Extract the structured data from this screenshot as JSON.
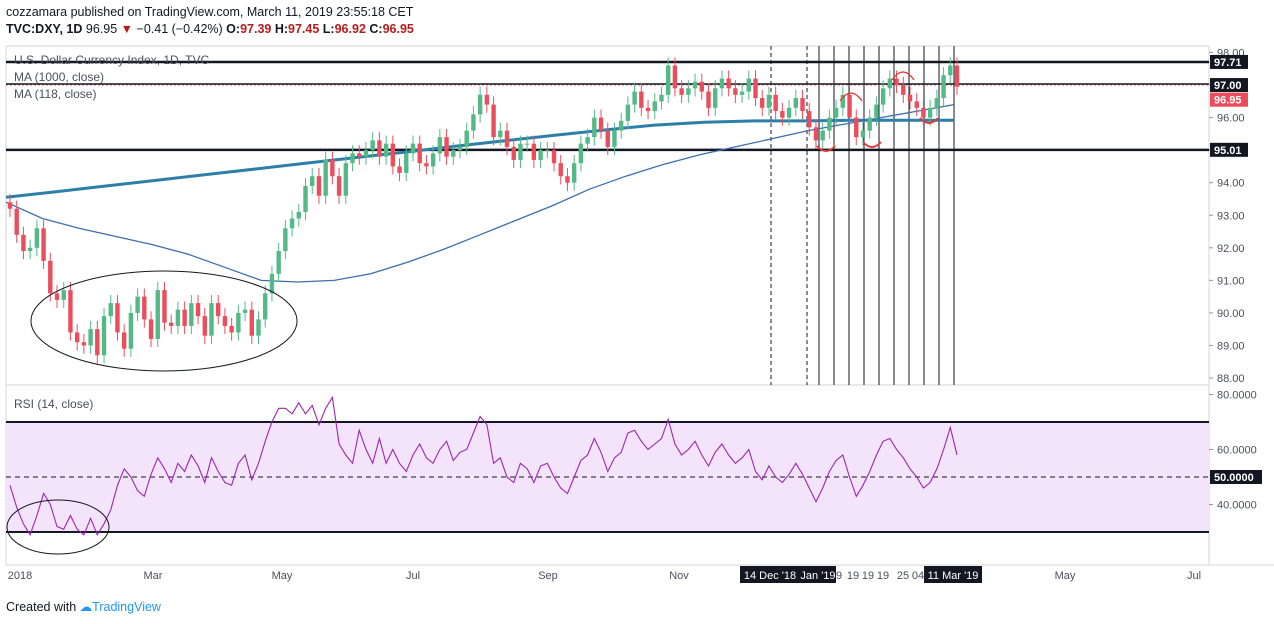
{
  "header": {
    "published_line": "cozzamara published on TradingView.com, March 11, 2019 23:55:18 CET",
    "symbol": "TVC:DXY, 1D",
    "last": "96.95",
    "change": "−0.41 (−0.42%)",
    "o_label": "O:",
    "o": "97.39",
    "h_label": "H:",
    "h": "97.45",
    "l_label": "L:",
    "l": "96.92",
    "c_label": "C:",
    "c": "96.95"
  },
  "legends": {
    "series_title": "U.S. Dollar Currency Index, 1D, TVC",
    "ma1000": "MA (1000, close)",
    "ma118": "MA (118, close)",
    "rsi": "RSI (14, close)"
  },
  "footer": {
    "created_with": "Created with",
    "brand": "TradingView"
  },
  "colors": {
    "bull": "#53b987",
    "bear": "#eb4d5c",
    "ma1000": "#2e7fa8",
    "ma118": "#3a6fb0",
    "rsi_line": "#9c27b0",
    "rsi_band": "#f3e3fb",
    "annotation_red": "#e53935"
  },
  "chart_data": [
    {
      "type": "candlestick",
      "title": "U.S. Dollar Currency Index, 1D, TVC",
      "ylim": [
        87.8,
        98.0
      ],
      "y_ticks": [
        "88.00",
        "89.00",
        "90.00",
        "91.00",
        "92.00",
        "93.00",
        "94.00",
        "95.00",
        "96.00",
        "97.00",
        "98.00"
      ],
      "x_ticks": [
        "2018",
        "Mar",
        "May",
        "Jul",
        "Sep",
        "Nov",
        "14 Dec '18",
        "Jan '19",
        "9",
        "19",
        "19",
        "19",
        "25",
        "04",
        "11 Mar '19",
        "May",
        "Jul"
      ],
      "horizontal_levels": [
        "97.71",
        "97.00",
        "95.01"
      ],
      "price_tags": [
        "97.71",
        "97.00",
        "96.95",
        "95.01"
      ],
      "closes": [
        93.2,
        92.4,
        91.9,
        92.0,
        92.6,
        91.6,
        90.6,
        90.4,
        90.7,
        89.4,
        89.1,
        89.0,
        89.5,
        88.7,
        89.9,
        90.3,
        89.4,
        88.9,
        90.0,
        90.5,
        89.8,
        89.2,
        90.7,
        89.7,
        89.6,
        90.1,
        89.6,
        90.3,
        89.9,
        89.3,
        90.3,
        89.9,
        89.6,
        89.4,
        90.0,
        90.1,
        89.3,
        89.8,
        90.6,
        91.2,
        91.9,
        92.6,
        92.9,
        93.1,
        93.9,
        94.2,
        93.6,
        94.7,
        94.2,
        93.6,
        94.6,
        94.9,
        94.8,
        95.0,
        95.3,
        94.8,
        95.2,
        94.5,
        94.3,
        94.9,
        95.2,
        94.6,
        94.5,
        94.9,
        95.4,
        94.8,
        95.0,
        95.1,
        95.6,
        96.1,
        96.7,
        96.4,
        95.4,
        95.6,
        95.1,
        94.7,
        95.2,
        95.2,
        94.7,
        95.0,
        95.0,
        94.6,
        94.2,
        94.0,
        94.6,
        95.2,
        95.4,
        96.0,
        95.6,
        95.1,
        95.6,
        95.9,
        96.4,
        96.8,
        96.3,
        96.2,
        96.5,
        96.7,
        97.6,
        96.9,
        96.7,
        96.9,
        97.1,
        96.8,
        96.3,
        96.9,
        97.2,
        96.9,
        96.7,
        96.8,
        97.2,
        96.6,
        96.3,
        96.7,
        96.2,
        96.0,
        96.3,
        96.6,
        96.2,
        95.7,
        95.3,
        95.6,
        96.0,
        96.3,
        96.7,
        96.0,
        95.4,
        95.6,
        96.0,
        96.4,
        96.9,
        97.2,
        97.0,
        96.7,
        96.5,
        96.3,
        96.0,
        96.3,
        96.6,
        97.3,
        97.6,
        96.95
      ],
      "ma1000": [
        93.55,
        93.72,
        93.9,
        94.07,
        94.25,
        94.42,
        94.6,
        94.77,
        94.94,
        95.12,
        95.29,
        95.46,
        95.62,
        95.77,
        95.86,
        95.9,
        95.9,
        95.92,
        95.92,
        95.92
      ],
      "ma118": [
        93.4,
        92.9,
        92.6,
        92.35,
        92.1,
        91.8,
        91.4,
        91.0,
        90.95,
        91.0,
        91.2,
        91.55,
        91.95,
        92.4,
        92.85,
        93.3,
        93.8,
        94.2,
        94.55,
        94.85,
        95.1,
        95.35,
        95.6,
        95.8,
        96.0,
        96.2,
        96.4
      ],
      "annotations": [
        "ellipse: early-2018 consolidation",
        "red arcs: swing lows and highs Jan–Mar 2019"
      ]
    },
    {
      "type": "line",
      "title": "RSI (14, close)",
      "ylim": [
        28,
        82
      ],
      "y_ticks": [
        "40.0000",
        "50.0000",
        "60.0000",
        "80.0000"
      ],
      "horizontal_levels": [
        70,
        50,
        30
      ],
      "highlight_tag": "50.0000",
      "values": [
        47,
        39,
        33,
        29,
        36,
        44,
        40,
        32,
        31,
        36,
        31,
        29,
        35,
        29,
        33,
        38,
        47,
        53,
        50,
        45,
        43,
        51,
        57,
        53,
        48,
        55,
        52,
        58,
        54,
        48,
        57,
        52,
        48,
        47,
        55,
        58,
        49,
        55,
        63,
        70,
        75,
        75,
        73,
        77,
        73,
        76,
        69,
        75,
        79,
        62,
        58,
        55,
        67,
        60,
        55,
        64,
        55,
        60,
        55,
        52,
        58,
        62,
        57,
        55,
        60,
        63,
        56,
        59,
        60,
        66,
        72,
        69,
        55,
        57,
        50,
        48,
        55,
        53,
        48,
        54,
        55,
        50,
        46,
        44,
        50,
        56,
        58,
        64,
        59,
        52,
        57,
        59,
        66,
        67,
        63,
        60,
        62,
        64,
        71,
        62,
        58,
        60,
        63,
        58,
        54,
        59,
        62,
        58,
        55,
        57,
        60,
        52,
        49,
        54,
        50,
        48,
        51,
        55,
        51,
        46,
        41,
        46,
        52,
        56,
        58,
        50,
        43,
        47,
        52,
        58,
        63,
        64,
        60,
        57,
        53,
        50,
        46,
        48,
        53,
        60,
        68,
        58
      ]
    }
  ]
}
